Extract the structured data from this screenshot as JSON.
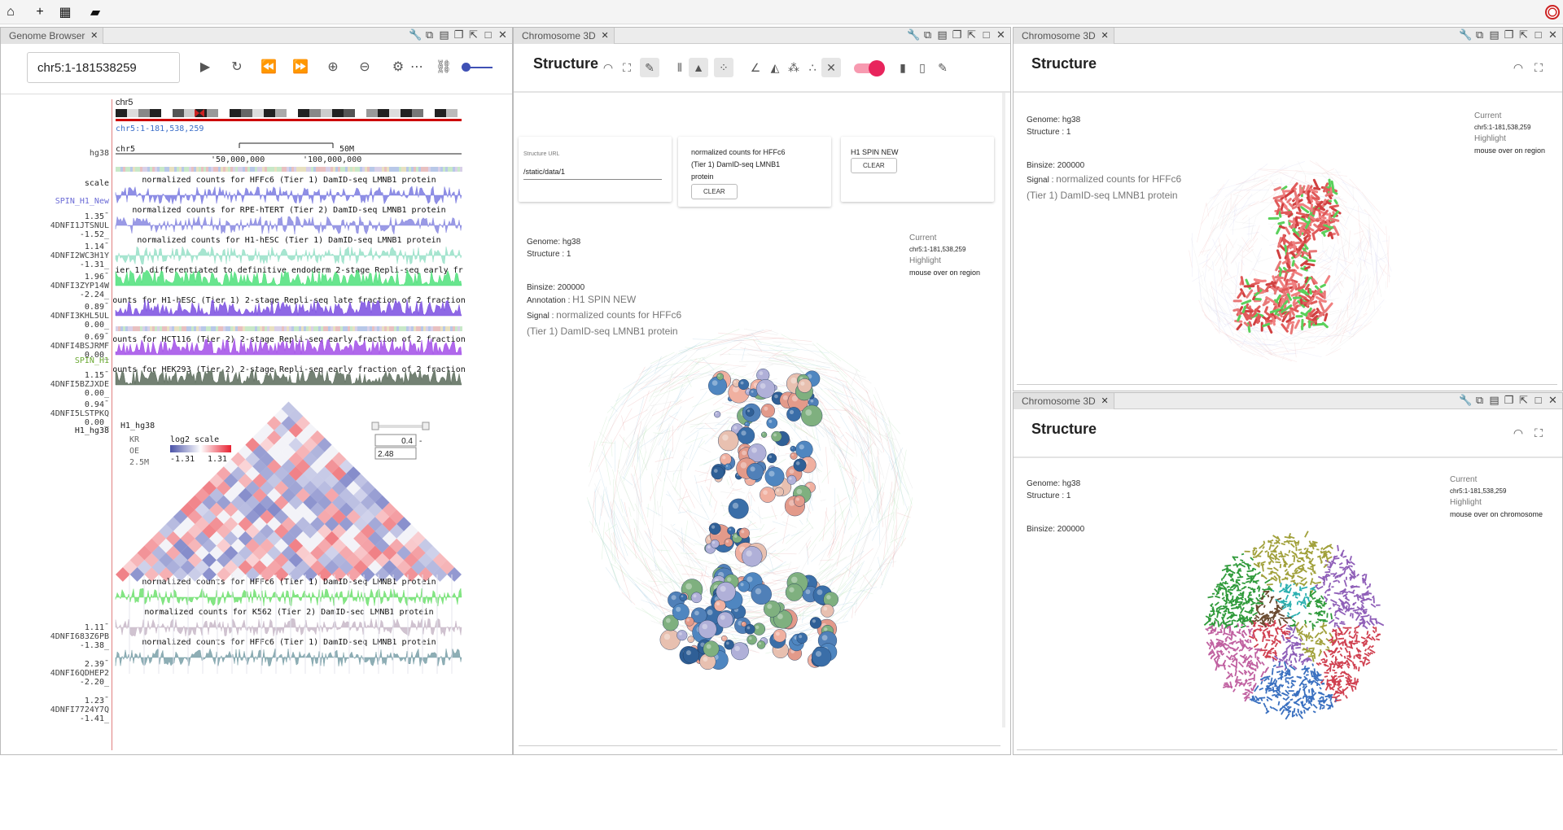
{
  "topbar": {
    "buttons": [
      "home-icon",
      "plus-icon",
      "grid-icon",
      "layers-icon"
    ]
  },
  "genome_browser": {
    "tab_label": "Genome Browser",
    "locus": "chr5:1-181538259",
    "assembly": "hg38",
    "chrom": "chr5",
    "coords": "chr5:1-181,538,259",
    "scale_label": "scale",
    "ruler_chrom": "chr5",
    "ruler_50M": "50M",
    "ruler_ticks": [
      "50,000,000",
      "100,000,000"
    ],
    "track_names": [
      {
        "name": "hg38",
        "color": "#444"
      },
      {
        "name": "scale",
        "color": "#222"
      },
      {
        "name": "SPIN_H1_New",
        "color": "#6b6bd6"
      },
      {
        "name": "4DNFI1JTSNUL",
        "color": "#444"
      },
      {
        "name": "4DNFI2WC3H1Y",
        "color": "#444"
      },
      {
        "name": "4DNFI3ZYP14W",
        "color": "#444"
      },
      {
        "name": "4DNFI3KHL5UL",
        "color": "#444"
      },
      {
        "name": "4DNFI4BSJRMF",
        "color": "#444"
      },
      {
        "name": "SPIN_H1",
        "color": "#6aa832"
      },
      {
        "name": "4DNFI5BZJXDE",
        "color": "#444"
      },
      {
        "name": "4DNFI5LSTPKQ",
        "color": "#444"
      },
      {
        "name": "H1_hg38",
        "color": "#222"
      },
      {
        "name": "4DNFI683Z6PB",
        "color": "#444"
      },
      {
        "name": "4DNFI6QDHEP2",
        "color": "#444"
      },
      {
        "name": "4DNFI7724Y7Q",
        "color": "#444"
      }
    ],
    "signal_tracks": [
      {
        "title": "normalized counts for HFFc6 (Tier 1) DamID-seq LMNB1 protein",
        "max": "1.35",
        "min": "-1.52",
        "color": "#7b7be0"
      },
      {
        "title": "normalized counts for RPE-hTERT (Tier 2) DamID-seq LMNB1 protein",
        "max": "1.14",
        "min": "-1.31",
        "color": "#8888e0"
      },
      {
        "title": "normalized counts for H1-hESC (Tier 1) DamID-seq LMNB1 protein",
        "max": "1.96",
        "min": "-2.24",
        "color": "#98e0c8"
      },
      {
        "title": "ier 1) differentiated to definitive endoderm 2-stage Repli-seq early fr",
        "max": "0.89",
        "min": "0.00",
        "color": "#4ee07a"
      },
      {
        "title": "ounts for H1-hESC (Tier 1) 2-stage Repli-seq late fraction of 2 fraction",
        "max": "0.69",
        "min": "0.00",
        "color": "#7a4ee0"
      },
      {
        "title": "ounts for HCT116 (Tier 2) 2-stage Repli-seq early fraction of 2 fraction",
        "max": "1.15",
        "min": "0.00",
        "color": "#a24ee8"
      },
      {
        "title": "ounts for HEK293 (Tier 2) 2-stage Repli-seq early fraction of 2 fraction",
        "max": "0.94",
        "min": "0.00",
        "color": "#5a6b5a"
      },
      {
        "title": "normalized counts for HFFc6 (Tier 1) DamID-seq LMNB1 protein",
        "max": "1.11",
        "min": "-1.38",
        "color": "#6ee06e"
      },
      {
        "title": "normalized counts for K562 (Tier 2) DamID-seq LMNB1 protein",
        "max": "2.39",
        "min": "-2.20",
        "color": "#c8b8c8"
      },
      {
        "title": "normalized counts for HFFc6 (Tier 1) DamID-seq LMNB1 protein",
        "max": "1.23",
        "min": "-1.41",
        "color": "#7aa0a8"
      }
    ],
    "hic": {
      "name": "H1_hg38",
      "norm": "KR",
      "mode": "OE",
      "resolution": "2.5M",
      "scale_title": "log2 scale",
      "scale_min": "-1.31",
      "scale_max": "1.31",
      "input_low": "0.4",
      "input_high": "2.48"
    }
  },
  "chrom3d_main": {
    "tab_label": "Chromosome 3D",
    "title": "Structure",
    "structure_url_label": "Structure URL",
    "structure_url": "/static/data/1",
    "annotation_card_text": "normalized counts for HFFc6 (Tier 1) DamID-seq LMNB1 protein",
    "spin_card_text": "H1 SPIN NEW",
    "clear_label": "CLEAR",
    "genome_line": "Genome: hg38",
    "structure_line": "Structure : 1",
    "binsize_line": "Binsize: 200000",
    "annotation_key": "Annotation :",
    "annotation_val": "H1 SPIN NEW",
    "signal_key": "Signal :",
    "signal_val": "normalized counts for HFFc6 (Tier 1) DamID-seq LMNB1 protein",
    "current_label": "Current",
    "current_val": "chr5:1-181,538,259",
    "highlight_label": "Highlight",
    "highlight_val": "mouse over on region"
  },
  "chrom3d_top": {
    "tab_label": "Chromosome 3D",
    "title": "Structure",
    "genome_line": "Genome: hg38",
    "structure_line": "Structure : 1",
    "binsize_line": "Binsize: 200000",
    "signal_key": "Signal :",
    "signal_val": "normalized counts for HFFc6 (Tier 1) DamID-seq LMNB1 protein",
    "current_label": "Current",
    "current_val": "chr5:1-181,538,259",
    "highlight_label": "Highlight",
    "highlight_val": "mouse over on region"
  },
  "chrom3d_bottom": {
    "tab_label": "Chromosome 3D",
    "title": "Structure",
    "genome_line": "Genome: hg38",
    "structure_line": "Structure : 1",
    "binsize_line": "Binsize: 200000",
    "current_label": "Current",
    "current_val": "chr5:1-181,538,259",
    "highlight_label": "Highlight",
    "highlight_val": "mouse over on chromosome"
  }
}
